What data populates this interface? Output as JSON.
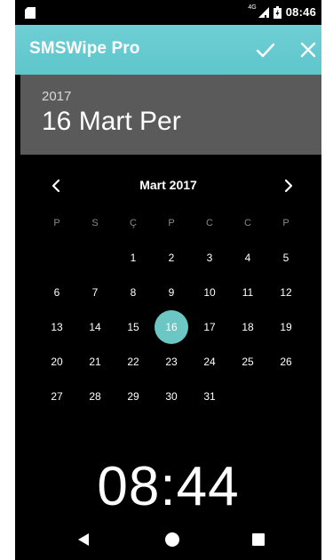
{
  "status_bar": {
    "network": "4G",
    "time": "08:46"
  },
  "app_bar": {
    "title": "SMSWipe Pro"
  },
  "date_header": {
    "year": "2017",
    "date": "16 Mart Per"
  },
  "calendar": {
    "month_title": "Mart 2017",
    "weekdays": [
      "P",
      "S",
      "Ç",
      "P",
      "C",
      "C",
      "P"
    ],
    "days": [
      "1",
      "2",
      "3",
      "4",
      "5",
      "6",
      "7",
      "8",
      "9",
      "10",
      "11",
      "12",
      "13",
      "14",
      "15",
      "16",
      "17",
      "18",
      "19",
      "20",
      "21",
      "22",
      "23",
      "24",
      "25",
      "26",
      "27",
      "28",
      "29",
      "30",
      "31"
    ],
    "selected_day": "16"
  },
  "time_display": "08:44",
  "colors": {
    "accent": "#6cc6c4",
    "app_bar": "#5ec6cc",
    "header_bg": "#5a5a5a"
  },
  "icons": {
    "sim": "sim-card-icon",
    "signal": "signal-icon",
    "battery": "battery-icon",
    "confirm": "check-icon",
    "cancel": "close-icon",
    "prev": "chevron-left-icon",
    "next": "chevron-right-icon",
    "back": "back-icon",
    "home": "home-icon",
    "recent": "recent-apps-icon"
  }
}
